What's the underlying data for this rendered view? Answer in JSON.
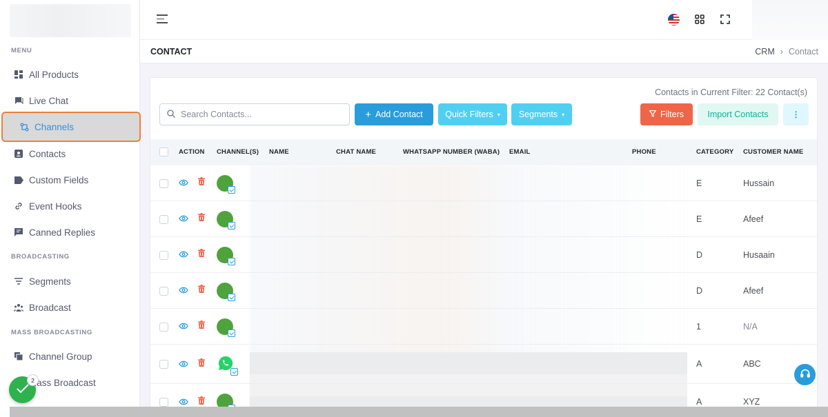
{
  "sidebar": {
    "sections": [
      {
        "title": "MENU"
      },
      {
        "title": "BROADCASTING"
      },
      {
        "title": "MASS BROADCASTING"
      }
    ],
    "items": [
      {
        "label": "All Products",
        "icon": "grid-icon"
      },
      {
        "label": "Live Chat",
        "icon": "chat-icon"
      },
      {
        "label": "Channels",
        "icon": "channels-icon",
        "active": true
      },
      {
        "label": "Contacts",
        "icon": "contacts-icon"
      },
      {
        "label": "Custom Fields",
        "icon": "tag-icon"
      },
      {
        "label": "Event Hooks",
        "icon": "link-icon"
      },
      {
        "label": "Canned Replies",
        "icon": "message-icon"
      },
      {
        "label": "Segments",
        "icon": "filter-lines-icon"
      },
      {
        "label": "Broadcast",
        "icon": "users-icon"
      },
      {
        "label": "Channel Group",
        "icon": "copy-icon"
      },
      {
        "label": "Mass Broadcast",
        "icon": "broadcast-icon"
      }
    ]
  },
  "header": {
    "icons": [
      "flag-us-icon",
      "apps-grid-icon",
      "fullscreen-icon"
    ]
  },
  "page": {
    "title": "CONTACT",
    "breadcrumb": [
      "CRM",
      "Contact"
    ]
  },
  "toolbar": {
    "filter_count": "Contacts in Current Filter: 22 Contact(s)",
    "search_placeholder": "Search Contacts...",
    "add_contact": "Add Contact",
    "quick_filters": "Quick Filters",
    "segments": "Segments",
    "filters": "Filters",
    "import_contacts": "Import Contacts"
  },
  "table": {
    "columns": [
      "ACTION",
      "CHANNEL(S)",
      "NAME",
      "CHAT NAME",
      "WHATSAPP NUMBER (WABA)",
      "EMAIL",
      "PHONE",
      "CATEGORY",
      "CUSTOMER NAME"
    ],
    "rows": [
      {
        "channel": "green",
        "category": "E",
        "customer": "Hussain"
      },
      {
        "channel": "green",
        "category": "E",
        "customer": "Afeef"
      },
      {
        "channel": "green",
        "category": "D",
        "customer": "Husaain"
      },
      {
        "channel": "green",
        "category": "D",
        "customer": "Afeef"
      },
      {
        "channel": "green",
        "category": "1",
        "customer": "N/A"
      },
      {
        "channel": "whatsapp",
        "category": "A",
        "customer": "ABC"
      },
      {
        "channel": "green",
        "category": "A",
        "customer": "XYZ"
      }
    ]
  },
  "floating": {
    "badge_count": "2"
  },
  "colors": {
    "primary": "#299cdb",
    "info": "#4fd0f3",
    "danger": "#f06548",
    "success": "#0ab39c",
    "active_outline": "#f07e3a"
  }
}
